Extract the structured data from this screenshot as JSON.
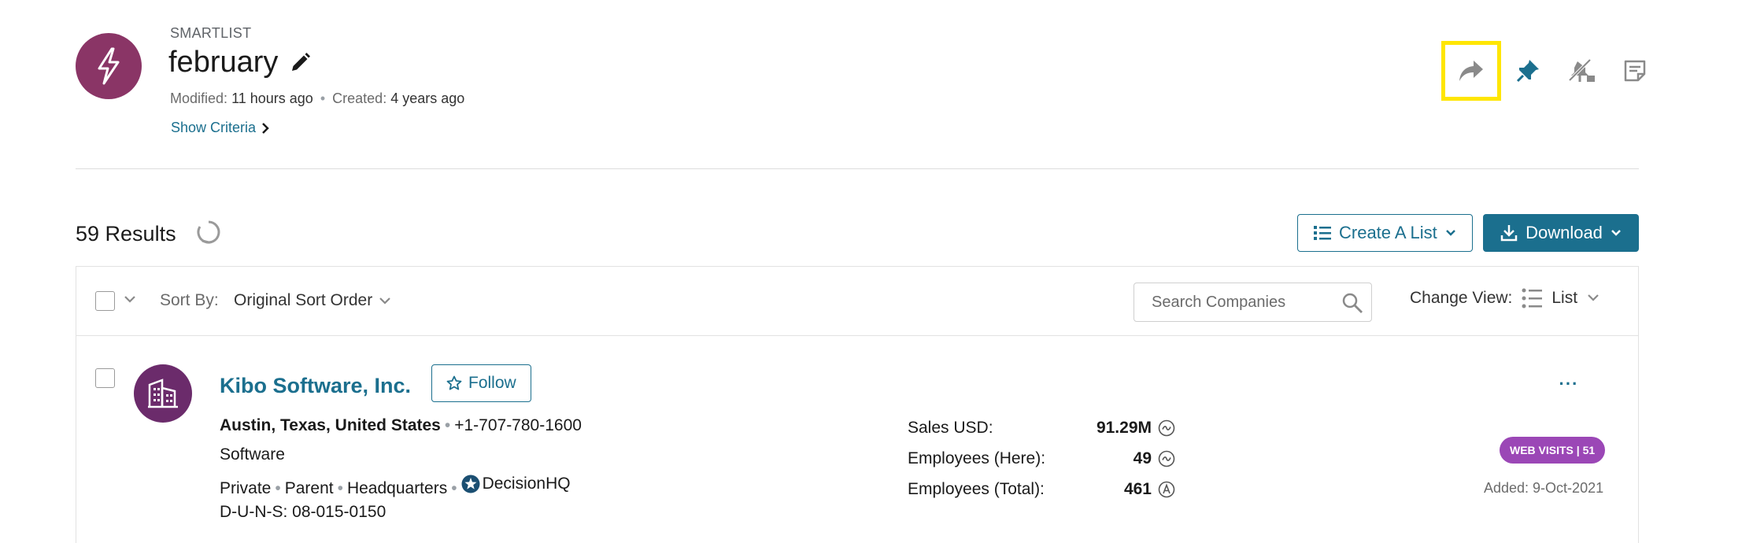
{
  "header": {
    "eyebrow": "SMARTLIST",
    "title": "february",
    "modified_label": "Modified:",
    "modified_value": "11 hours ago",
    "created_label": "Created:",
    "created_value": "4 years ago",
    "show_criteria": "Show Criteria",
    "actions": [
      {
        "name": "share-icon"
      },
      {
        "name": "pin-icon"
      },
      {
        "name": "unpin-icon"
      },
      {
        "name": "notes-icon"
      }
    ]
  },
  "results": {
    "count_label": "59 Results",
    "create_list": "Create A List",
    "download": "Download"
  },
  "toolbar": {
    "sort_label": "Sort By:",
    "sort_value": "Original Sort Order",
    "search_placeholder": "Search Companies",
    "change_view_label": "Change View:",
    "view_value": "List"
  },
  "company": {
    "name": "Kibo Software, Inc.",
    "follow": "Follow",
    "location": "Austin, Texas, United States",
    "phone": "+1-707-780-1600",
    "industry": "Software",
    "ownership": "Private",
    "hierarchy": "Parent",
    "site_type": "Headquarters",
    "decision_hq": "DecisionHQ",
    "duns": "D-U-N-S: 08-015-0150",
    "sales_label": "Sales USD:",
    "sales_value": "91.29M",
    "emp_here_label": "Employees (Here):",
    "emp_here_value": "49",
    "emp_total_label": "Employees (Total):",
    "emp_total_value": "461",
    "more": "···",
    "web_visits": "WEB VISITS | 51",
    "added": "Added: 9-Oct-2021"
  },
  "colors": {
    "accent": "#1b6f8e",
    "list_avatar": "#8a3566",
    "company_avatar": "#6b2b6b",
    "badge": "#9b47b6",
    "highlight": "#ffe600"
  }
}
